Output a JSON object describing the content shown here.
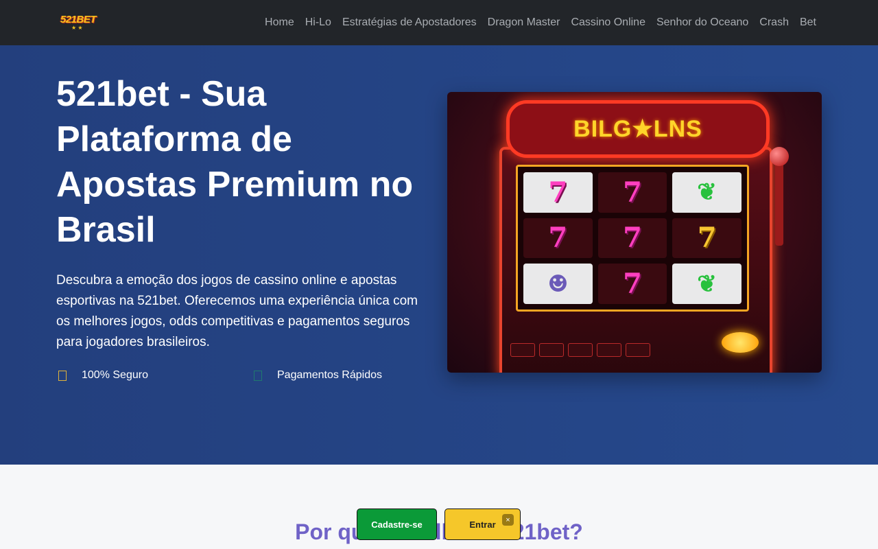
{
  "brand": {
    "logo_text": "521BET",
    "logo_stars": "★ ★"
  },
  "nav": {
    "items": [
      {
        "label": "Home"
      },
      {
        "label": "Hi-Lo"
      },
      {
        "label": "Estratégias de Apostadores"
      },
      {
        "label": "Dragon Master"
      },
      {
        "label": "Cassino Online"
      },
      {
        "label": "Senhor do Oceano"
      },
      {
        "label": "Crash"
      },
      {
        "label": "Bet"
      }
    ]
  },
  "hero": {
    "title": "521bet - Sua Plataforma de Apostas Premium no Brasil",
    "description": "Descubra a emoção dos jogos de cassino online e apostas esportivas na 521bet. Oferecemos uma experiência única com os melhores jogos, odds competitivas e pagamentos seguros para jogadores brasileiros.",
    "features": [
      {
        "label": "100% Seguro"
      },
      {
        "label": "Pagamentos Rápidos"
      }
    ],
    "image": {
      "marquee_text": "BILG★LNS",
      "reels": [
        {
          "symbol": "7"
        },
        {
          "symbol": "7"
        },
        {
          "symbol": "❦"
        },
        {
          "symbol": "7"
        },
        {
          "symbol": "7"
        },
        {
          "symbol": "7"
        },
        {
          "symbol": "☻"
        },
        {
          "symbol": "7"
        },
        {
          "symbol": "❦"
        }
      ]
    }
  },
  "section": {
    "title": "Por que Escolher a 521bet?"
  },
  "cta": {
    "register_label": "Cadastre-se",
    "login_label": "Entrar",
    "close_label": "×"
  },
  "colors": {
    "navbar_bg": "#222529",
    "hero_bg": "#26498d",
    "section_title": "#6f62c7",
    "register_btn": "#0b9a38",
    "login_btn": "#f5c72a"
  }
}
